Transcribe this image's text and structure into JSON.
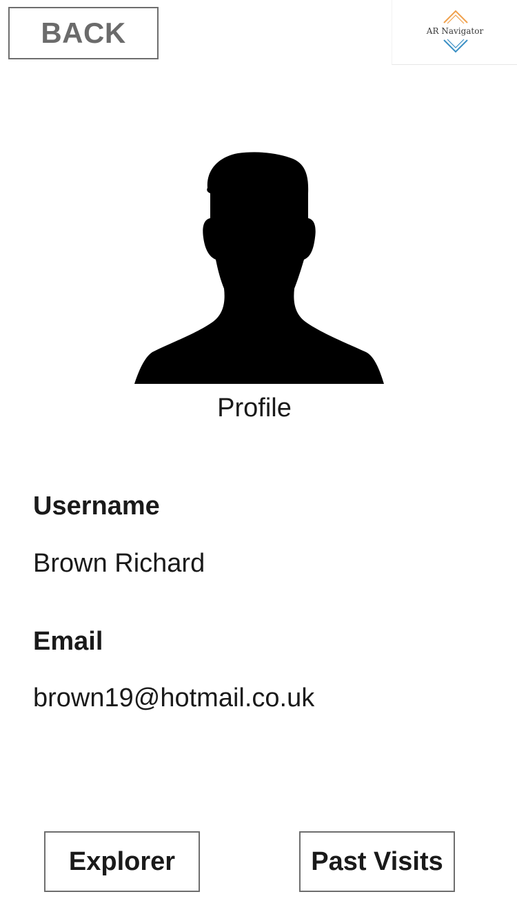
{
  "header": {
    "back_label": "BACK",
    "logo_text": "AR Navigator",
    "logo_colors": {
      "top_chevron": "#f0a04b",
      "bottom_chevron": "#3a8fc4"
    }
  },
  "profile": {
    "caption": "Profile",
    "avatar_icon": "person-silhouette-icon"
  },
  "fields": {
    "username_label": "Username",
    "username_value": "Brown Richard",
    "email_label": "Email",
    "email_value": "brown19@hotmail.co.uk"
  },
  "bottom_nav": {
    "explorer_label": "Explorer",
    "past_visits_label": "Past Visits"
  }
}
